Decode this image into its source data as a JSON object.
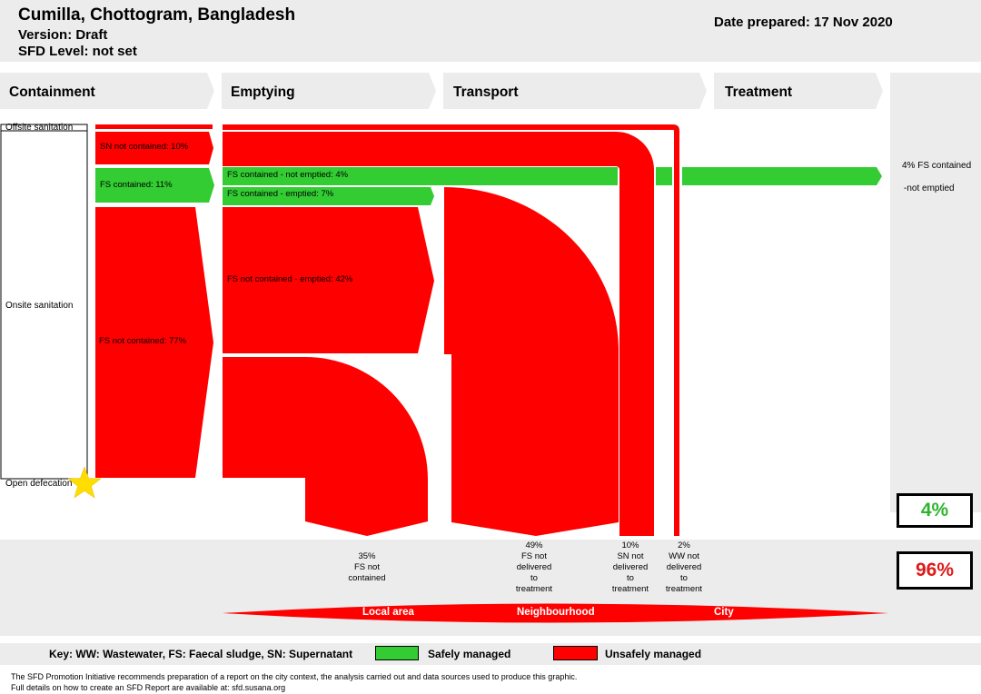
{
  "header": {
    "title": "Cumilla, Chottogram, Bangladesh",
    "version": "Version: Draft",
    "sfd_level": "SFD Level: not set",
    "date_prepared": "Date prepared: 17 Nov 2020"
  },
  "stages": [
    "Containment",
    "Emptying",
    "Transport",
    "Treatment"
  ],
  "containment_types": {
    "offsite": "Offsite sanitation",
    "onsite": "Onsite sanitation",
    "open": "Open defecation"
  },
  "flows": {
    "sn_not_contained": "SN not contained: 10%",
    "fs_contained": "FS contained: 11%",
    "fs_not_contained": "FS not contained: 77%",
    "fs_contained_not_emptied": "FS contained - not emptied: 4%",
    "fs_contained_emptied": "FS contained - emptied: 7%",
    "fs_not_contained_emptied": "FS not contained - emptied: 42%"
  },
  "side_note": [
    "4% FS contained",
    "-not emptied"
  ],
  "totals": {
    "safe": "4%",
    "unsafe": "96%"
  },
  "outcomes": [
    [
      "35%",
      "FS not",
      "contained"
    ],
    [
      "49%",
      "FS not",
      "delivered",
      "to",
      "treatment"
    ],
    [
      "10%",
      "SN not",
      "delivered",
      "to",
      "treatment"
    ],
    [
      "2%",
      "WW not",
      "delivered",
      "to",
      "treatment"
    ]
  ],
  "areas": [
    "Local area",
    "Neighbourhood",
    "City"
  ],
  "key": {
    "text": "Key: WW: Wastewater, FS: Faecal sludge, SN: Supernatant",
    "safe": "Safely managed",
    "unsafe": "Unsafely managed"
  },
  "disclaimer": [
    "The SFD Promotion Initiative recommends preparation of a report on the city context, the analysis carried out and data sources used to produce this graphic.",
    "Full details on how to create an SFD Report are available at: sfd.susana.org"
  ],
  "colors": {
    "safe": "#33cc33",
    "unsafe": "#ff0000",
    "panel": "#ececec",
    "ribbon": "#ff0000"
  }
}
